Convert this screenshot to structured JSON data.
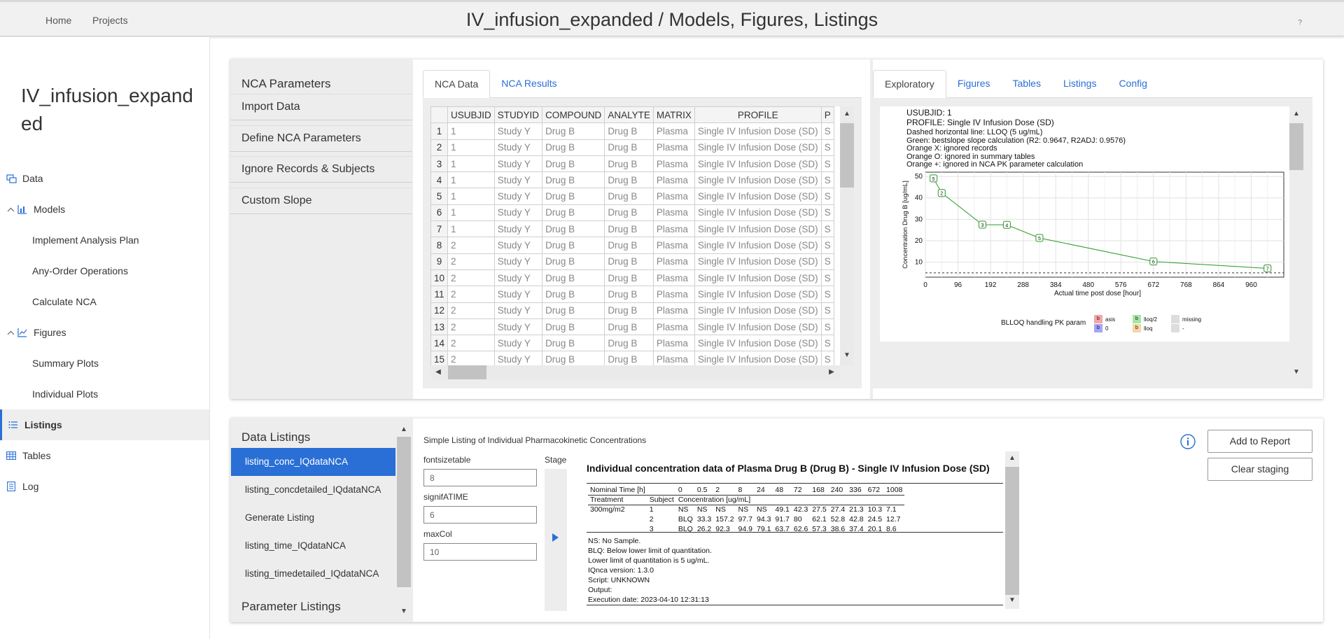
{
  "topbar": {
    "nav": [
      "Home",
      "Projects"
    ],
    "title": "IV_infusion_expanded / Models, Figures, Listings",
    "help": "?"
  },
  "sidebar": {
    "project_name": "IV_infusion_expanded",
    "items": [
      {
        "label": "Data"
      },
      {
        "label": "Models"
      },
      {
        "label": "Implement Analysis Plan"
      },
      {
        "label": "Any-Order Operations"
      },
      {
        "label": "Calculate NCA"
      },
      {
        "label": "Figures"
      },
      {
        "label": "Summary Plots"
      },
      {
        "label": "Individual Plots"
      },
      {
        "label": "Listings"
      },
      {
        "label": "Tables"
      },
      {
        "label": "Log"
      }
    ]
  },
  "nca_panel": {
    "title": "NCA Parameters",
    "items": [
      "Import Data",
      "Define NCA Parameters",
      "Ignore Records & Subjects",
      "Custom Slope"
    ]
  },
  "data_tabs": [
    "NCA Data",
    "NCA Results"
  ],
  "data_table": {
    "headers": [
      "",
      "USUBJID",
      "STUDYID",
      "COMPOUND",
      "ANALYTE",
      "MATRIX",
      "PROFILE",
      "P"
    ],
    "rows": [
      [
        "1",
        "1",
        "Study Y",
        "Drug B",
        "Drug B",
        "Plasma",
        "Single IV Infusion Dose (SD)",
        "S"
      ],
      [
        "2",
        "1",
        "Study Y",
        "Drug B",
        "Drug B",
        "Plasma",
        "Single IV Infusion Dose (SD)",
        "S"
      ],
      [
        "3",
        "1",
        "Study Y",
        "Drug B",
        "Drug B",
        "Plasma",
        "Single IV Infusion Dose (SD)",
        "S"
      ],
      [
        "4",
        "1",
        "Study Y",
        "Drug B",
        "Drug B",
        "Plasma",
        "Single IV Infusion Dose (SD)",
        "S"
      ],
      [
        "5",
        "1",
        "Study Y",
        "Drug B",
        "Drug B",
        "Plasma",
        "Single IV Infusion Dose (SD)",
        "S"
      ],
      [
        "6",
        "1",
        "Study Y",
        "Drug B",
        "Drug B",
        "Plasma",
        "Single IV Infusion Dose (SD)",
        "S"
      ],
      [
        "7",
        "1",
        "Study Y",
        "Drug B",
        "Drug B",
        "Plasma",
        "Single IV Infusion Dose (SD)",
        "S"
      ],
      [
        "8",
        "2",
        "Study Y",
        "Drug B",
        "Drug B",
        "Plasma",
        "Single IV Infusion Dose (SD)",
        "S"
      ],
      [
        "9",
        "2",
        "Study Y",
        "Drug B",
        "Drug B",
        "Plasma",
        "Single IV Infusion Dose (SD)",
        "S"
      ],
      [
        "10",
        "2",
        "Study Y",
        "Drug B",
        "Drug B",
        "Plasma",
        "Single IV Infusion Dose (SD)",
        "S"
      ],
      [
        "11",
        "2",
        "Study Y",
        "Drug B",
        "Drug B",
        "Plasma",
        "Single IV Infusion Dose (SD)",
        "S"
      ],
      [
        "12",
        "2",
        "Study Y",
        "Drug B",
        "Drug B",
        "Plasma",
        "Single IV Infusion Dose (SD)",
        "S"
      ],
      [
        "13",
        "2",
        "Study Y",
        "Drug B",
        "Drug B",
        "Plasma",
        "Single IV Infusion Dose (SD)",
        "S"
      ],
      [
        "14",
        "2",
        "Study Y",
        "Drug B",
        "Drug B",
        "Plasma",
        "Single IV Infusion Dose (SD)",
        "S"
      ],
      [
        "15",
        "2",
        "Study Y",
        "Drug B",
        "Drug B",
        "Plasma",
        "Single IV Infusion Dose (SD)",
        "S"
      ]
    ]
  },
  "plot_tabs": [
    "Exploratory",
    "Figures",
    "Tables",
    "Listings",
    "Config"
  ],
  "plot": {
    "usubjid": "USUBJID: 1",
    "profile": "PROFILE: Single IV Infusion Dose (SD)",
    "notes": [
      "Dashed horizontal line: LLOQ (5 ug/mL)",
      "Green: bestslope slope calculation (R2: 0.9647, R2ADJ: 0.9576)",
      "Orange X: ignored records",
      "Orange O: ignored in summary tables",
      "Orange +: ignored in NCA PK parameter calculation"
    ],
    "legend_title": "BLLOQ handling PK param",
    "legend": [
      {
        "sym": "b",
        "label": "asis",
        "color": "#f6a5a5"
      },
      {
        "sym": "b",
        "label": "lloq/2",
        "color": "#a5e6a5"
      },
      {
        "sym": "",
        "label": "missing",
        "color": "#dddddd"
      },
      {
        "sym": "b",
        "label": "0",
        "color": "#a5a5f6"
      },
      {
        "sym": "b",
        "label": "lloq",
        "color": "#f6d6a5"
      },
      {
        "sym": "",
        "label": "-",
        "color": "#dddddd"
      }
    ]
  },
  "chart_data": {
    "type": "line",
    "xlabel": "Actual time post dose [hour]",
    "ylabel": "Concentration Drug B [ug/mL]",
    "xticks": [
      0,
      96,
      192,
      288,
      384,
      480,
      576,
      672,
      768,
      864,
      960
    ],
    "yticks": [
      10,
      20,
      30,
      40,
      50
    ],
    "xlim": [
      0,
      1056
    ],
    "ylim": [
      3,
      52
    ],
    "lloq": 5,
    "series": [
      {
        "x": [
          24,
          48,
          168,
          240,
          336,
          672,
          1008
        ],
        "y": [
          49.1,
          42.3,
          27.5,
          27.4,
          21.3,
          10.3,
          7.1
        ],
        "labels": [
          "5",
          "2",
          "3",
          "4",
          "5",
          "6",
          "7"
        ],
        "color": "#2a9a2a"
      }
    ]
  },
  "listings_panel": {
    "data_title": "Data Listings",
    "items": [
      "listing_conc_IQdataNCA",
      "listing_concdetailed_IQdataNCA",
      "Generate Listing",
      "listing_time_IQdataNCA",
      "listing_timedetailed_IQdataNCA"
    ],
    "param_title": "Parameter Listings"
  },
  "listing": {
    "header": "Simple Listing of Individual Pharmacokinetic Concentrations",
    "fields": [
      {
        "label": "fontsizetable",
        "value": "8"
      },
      {
        "label": "signifATIME",
        "value": "6"
      },
      {
        "label": "maxCol",
        "value": "10"
      }
    ],
    "stage_label": "Stage",
    "title": "Individual concentration data of Plasma Drug B (Drug B) - Single IV Infusion Dose (SD)",
    "time_row": [
      "Nominal Time [h]",
      "",
      "0",
      "0.5",
      "2",
      "8",
      "24",
      "48",
      "72",
      "168",
      "240",
      "336",
      "672",
      "1008"
    ],
    "head_row": [
      "Treatment",
      "Subject",
      "Concentration [ug/mL]"
    ],
    "rows": [
      [
        "300mg/m2",
        "1",
        "NS",
        "NS",
        "NS",
        "NS",
        "NS",
        "49.1",
        "42.3",
        "27.5",
        "27.4",
        "21.3",
        "10.3",
        "7.1"
      ],
      [
        "",
        "2",
        "BLQ",
        "33.3",
        "157.2",
        "97.7",
        "94.3",
        "91.7",
        "80",
        "62.1",
        "52.8",
        "42.8",
        "24.5",
        "12.7"
      ],
      [
        "",
        "3",
        "BLQ",
        "26.2",
        "92.3",
        "94.9",
        "79.1",
        "63.7",
        "62.6",
        "57.3",
        "38.6",
        "37.4",
        "20.1",
        "8.6"
      ]
    ],
    "notes": [
      "NS: No Sample.",
      "BLQ: Below lower limit of quantitation.",
      "Lower limit of quantitation is 5 ug/mL.",
      "IQnca version: 1.3.0",
      "Script: UNKNOWN",
      "Output:",
      "Execution date: 2023-04-10 12:31:13"
    ]
  },
  "buttons": {
    "add": "Add to Report",
    "clear": "Clear staging"
  }
}
